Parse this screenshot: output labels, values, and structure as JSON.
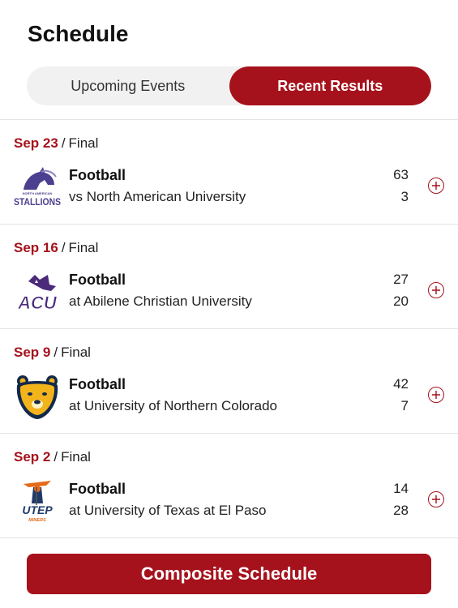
{
  "header": {
    "title": "Schedule"
  },
  "tabs": [
    {
      "label": "Upcoming Events",
      "active": false
    },
    {
      "label": "Recent Results",
      "active": true
    }
  ],
  "events": [
    {
      "date": "Sep 23",
      "status": "Final",
      "sport": "Football",
      "opponent": "vs North American University",
      "score_top": "63",
      "score_bottom": "3",
      "logo": "north-american-stallions-logo"
    },
    {
      "date": "Sep 16",
      "status": "Final",
      "sport": "Football",
      "opponent": "at Abilene Christian University",
      "score_top": "27",
      "score_bottom": "20",
      "logo": "acu-wildcats-logo"
    },
    {
      "date": "Sep 9",
      "status": "Final",
      "sport": "Football",
      "opponent": "at University of Northern Colorado",
      "score_top": "42",
      "score_bottom": "7",
      "logo": "northern-colorado-bear-logo"
    },
    {
      "date": "Sep 2",
      "status": "Final",
      "sport": "Football",
      "opponent": "at University of Texas at El Paso",
      "score_top": "14",
      "score_bottom": "28",
      "logo": "utep-miners-logo"
    }
  ],
  "logo_text": {
    "stallions_small": "NORTH AMERICAN",
    "stallions_main": "STALLIONS",
    "acu": "ACU",
    "utep": "UTEP",
    "utep_sub": "MINERS"
  },
  "footer": {
    "composite_label": "Composite Schedule"
  },
  "colors": {
    "accent": "#a6121c",
    "divider": "#e3e3e3",
    "toggle_bg": "#f1f1f1"
  }
}
